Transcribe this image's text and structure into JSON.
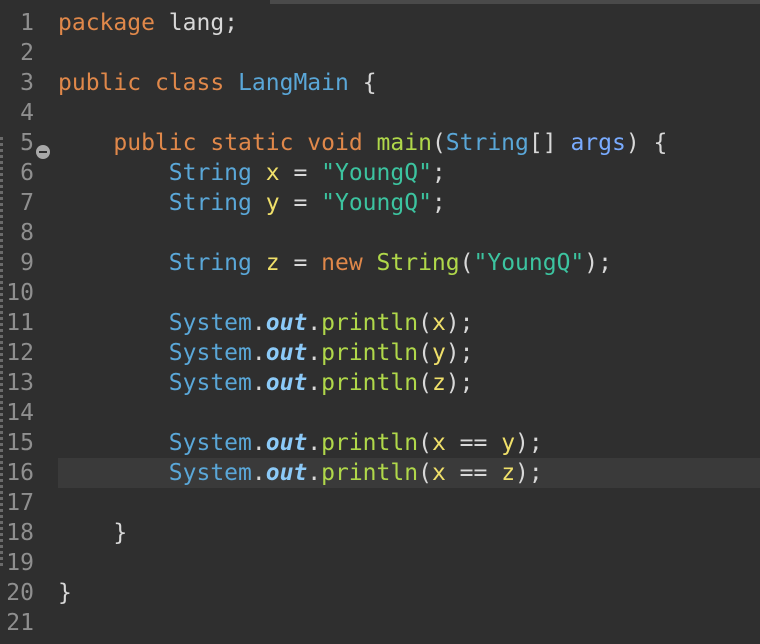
{
  "editor": {
    "line_numbers": [
      "1",
      "2",
      "3",
      "4",
      "5",
      "6",
      "7",
      "8",
      "9",
      "10",
      "11",
      "12",
      "13",
      "14",
      "15",
      "16",
      "17",
      "18",
      "19",
      "20",
      "21"
    ],
    "current_line": 16,
    "lines": [
      [
        {
          "t": "package",
          "k": "kw"
        },
        {
          "t": " lang;",
          "k": "plain"
        }
      ],
      [],
      [
        {
          "t": "public",
          "k": "kw"
        },
        {
          "t": " ",
          "k": "plain"
        },
        {
          "t": "class",
          "k": "kw"
        },
        {
          "t": " ",
          "k": "plain"
        },
        {
          "t": "LangMain",
          "k": "type"
        },
        {
          "t": " {",
          "k": "plain"
        }
      ],
      [],
      [
        {
          "t": "    ",
          "k": "plain"
        },
        {
          "t": "public",
          "k": "kw"
        },
        {
          "t": " ",
          "k": "plain"
        },
        {
          "t": "static",
          "k": "kw"
        },
        {
          "t": " ",
          "k": "plain"
        },
        {
          "t": "void",
          "k": "kw"
        },
        {
          "t": " ",
          "k": "plain"
        },
        {
          "t": "main",
          "k": "meth"
        },
        {
          "t": "(",
          "k": "plain"
        },
        {
          "t": "String",
          "k": "type"
        },
        {
          "t": "[] ",
          "k": "plain"
        },
        {
          "t": "args",
          "k": "param"
        },
        {
          "t": ") {",
          "k": "plain"
        }
      ],
      [
        {
          "t": "        ",
          "k": "plain"
        },
        {
          "t": "String",
          "k": "type"
        },
        {
          "t": " ",
          "k": "plain"
        },
        {
          "t": "x",
          "k": "var"
        },
        {
          "t": " = ",
          "k": "plain"
        },
        {
          "t": "\"YoungQ\"",
          "k": "str"
        },
        {
          "t": ";",
          "k": "plain"
        }
      ],
      [
        {
          "t": "        ",
          "k": "plain"
        },
        {
          "t": "String",
          "k": "type"
        },
        {
          "t": " ",
          "k": "plain"
        },
        {
          "t": "y",
          "k": "var"
        },
        {
          "t": " = ",
          "k": "plain"
        },
        {
          "t": "\"YoungQ\"",
          "k": "str"
        },
        {
          "t": ";",
          "k": "plain"
        }
      ],
      [],
      [
        {
          "t": "        ",
          "k": "plain"
        },
        {
          "t": "String",
          "k": "type"
        },
        {
          "t": " ",
          "k": "plain"
        },
        {
          "t": "z",
          "k": "var"
        },
        {
          "t": " = ",
          "k": "plain"
        },
        {
          "t": "new",
          "k": "kw"
        },
        {
          "t": " ",
          "k": "plain"
        },
        {
          "t": "String",
          "k": "meth"
        },
        {
          "t": "(",
          "k": "plain"
        },
        {
          "t": "\"YoungQ\"",
          "k": "str"
        },
        {
          "t": ");",
          "k": "plain"
        }
      ],
      [],
      [
        {
          "t": "        ",
          "k": "plain"
        },
        {
          "t": "System",
          "k": "type"
        },
        {
          "t": ".",
          "k": "plain"
        },
        {
          "t": "out",
          "k": "field"
        },
        {
          "t": ".",
          "k": "plain"
        },
        {
          "t": "println",
          "k": "meth"
        },
        {
          "t": "(",
          "k": "plain"
        },
        {
          "t": "x",
          "k": "var"
        },
        {
          "t": ");",
          "k": "plain"
        }
      ],
      [
        {
          "t": "        ",
          "k": "plain"
        },
        {
          "t": "System",
          "k": "type"
        },
        {
          "t": ".",
          "k": "plain"
        },
        {
          "t": "out",
          "k": "field"
        },
        {
          "t": ".",
          "k": "plain"
        },
        {
          "t": "println",
          "k": "meth"
        },
        {
          "t": "(",
          "k": "plain"
        },
        {
          "t": "y",
          "k": "var"
        },
        {
          "t": ");",
          "k": "plain"
        }
      ],
      [
        {
          "t": "        ",
          "k": "plain"
        },
        {
          "t": "System",
          "k": "type"
        },
        {
          "t": ".",
          "k": "plain"
        },
        {
          "t": "out",
          "k": "field"
        },
        {
          "t": ".",
          "k": "plain"
        },
        {
          "t": "println",
          "k": "meth"
        },
        {
          "t": "(",
          "k": "plain"
        },
        {
          "t": "z",
          "k": "var"
        },
        {
          "t": ");",
          "k": "plain"
        }
      ],
      [],
      [
        {
          "t": "        ",
          "k": "plain"
        },
        {
          "t": "System",
          "k": "type"
        },
        {
          "t": ".",
          "k": "plain"
        },
        {
          "t": "out",
          "k": "field"
        },
        {
          "t": ".",
          "k": "plain"
        },
        {
          "t": "println",
          "k": "meth"
        },
        {
          "t": "(",
          "k": "plain"
        },
        {
          "t": "x",
          "k": "var"
        },
        {
          "t": " == ",
          "k": "plain"
        },
        {
          "t": "y",
          "k": "var"
        },
        {
          "t": ");",
          "k": "plain"
        }
      ],
      [
        {
          "t": "        ",
          "k": "plain"
        },
        {
          "t": "System",
          "k": "type"
        },
        {
          "t": ".",
          "k": "plain"
        },
        {
          "t": "out",
          "k": "field"
        },
        {
          "t": ".",
          "k": "plain"
        },
        {
          "t": "println",
          "k": "meth"
        },
        {
          "t": "(",
          "k": "plain"
        },
        {
          "t": "x",
          "k": "var"
        },
        {
          "t": " == ",
          "k": "plain"
        },
        {
          "t": "z",
          "k": "var"
        },
        {
          "t": ");",
          "k": "plain"
        }
      ],
      [],
      [
        {
          "t": "    }",
          "k": "plain"
        }
      ],
      [],
      [
        {
          "t": "}",
          "k": "plain"
        }
      ],
      []
    ],
    "fold_icon": "collapse-minus-icon",
    "colors": {
      "background": "#2f2f2f",
      "keyword": "#e0884a",
      "type": "#5aa7d8",
      "variable": "#f0e06a",
      "string": "#3cc4a0",
      "method": "#b0d84a",
      "field": "#8ccaf8",
      "current_line": "#3a3a3a"
    }
  }
}
